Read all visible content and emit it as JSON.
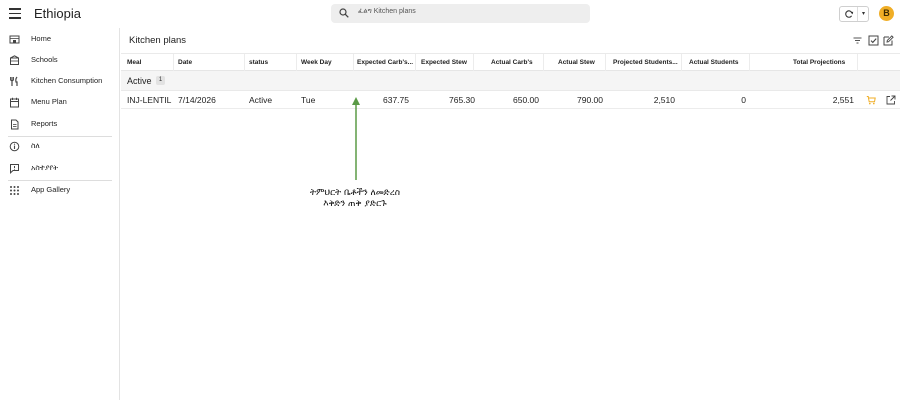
{
  "app": {
    "title": "Ethiopia",
    "avatar_initial": "B",
    "accent_color": "#f0ae26"
  },
  "search": {
    "placeholder": "ፈልግ Kitchen plans"
  },
  "sidebar": {
    "items": [
      {
        "label": "Home",
        "icon": "home-icon"
      },
      {
        "label": "Schools",
        "icon": "school-icon"
      },
      {
        "label": "Kitchen Consumption",
        "icon": "utensils-icon"
      },
      {
        "label": "Menu Plan",
        "icon": "calendar-icon"
      },
      {
        "label": "Reports",
        "icon": "document-icon"
      },
      {
        "label": "ስለ",
        "icon": "info-icon"
      },
      {
        "label": "አስተያየት",
        "icon": "feedback-icon"
      },
      {
        "label": "App Gallery",
        "icon": "grid-icon"
      }
    ]
  },
  "main": {
    "title": "Kitchen plans",
    "columns": [
      "Meal",
      "Date",
      "status",
      "Week Day",
      "Expected Carb's...",
      "Expected Stew",
      "Actual Carb's",
      "Actual Stew",
      "Projected Students...",
      "Actual Students",
      "Total Projections"
    ],
    "group": {
      "label": "Active",
      "count": "1"
    },
    "rows": [
      {
        "meal": "INJ-LENTIL",
        "date": "7/14/2026",
        "status": "Active",
        "week_day": "Tue",
        "expected_carbs": "637.75",
        "expected_stew": "765.30",
        "actual_carbs": "650.00",
        "actual_stew": "790.00",
        "projected_students": "2,510",
        "actual_students": "0",
        "total_projections": "2,551"
      }
    ]
  },
  "annotation": {
    "line1": "ትምህርት ቤቶችን ለመድረስ",
    "line2": "እቅድን ጠቅ ያድርጉ",
    "color": "#5a9a46"
  }
}
